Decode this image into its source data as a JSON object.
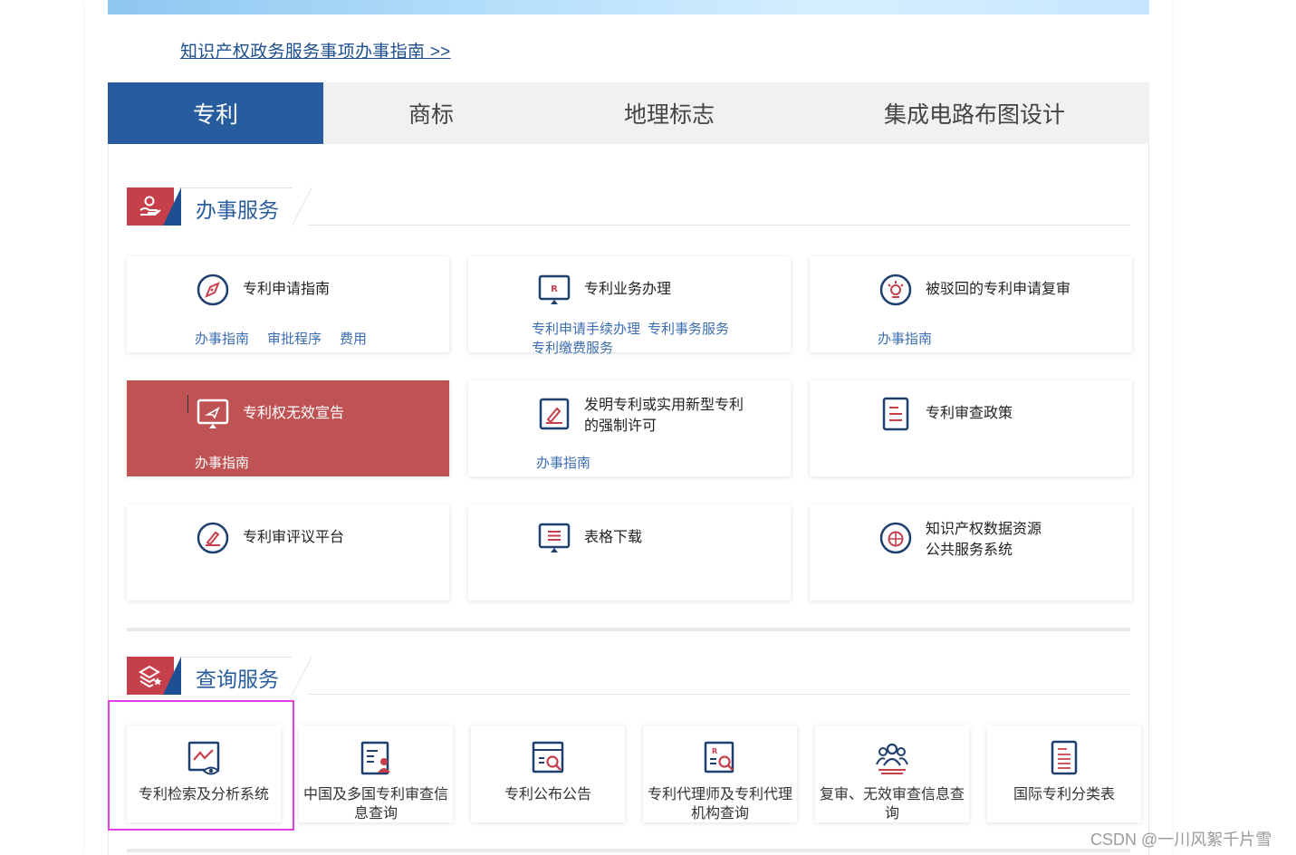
{
  "guide_link": "知识产权政务服务事项办事指南 >>",
  "tabs": [
    {
      "label": "专利",
      "active": true
    },
    {
      "label": "商标",
      "active": false
    },
    {
      "label": "地理标志",
      "active": false
    },
    {
      "label": "集成电路布图设计",
      "active": false
    }
  ],
  "sections": {
    "affairs": {
      "title": "办事服务",
      "icon": "hand-service-icon"
    },
    "query": {
      "title": "查询服务",
      "icon": "stack-star-icon"
    }
  },
  "affair_cards": [
    {
      "title": "专利申请指南",
      "icon": "compass-icon",
      "links": [
        "办事指南",
        "审批程序",
        "费用"
      ]
    },
    {
      "title": "专利业务办理",
      "icon": "monitor-r-icon",
      "links": [
        "专利申请手续办理",
        "专利事务服务",
        "专利缴费服务"
      ]
    },
    {
      "title": "被驳回的专利申请复审",
      "icon": "bulb-icon",
      "links": [
        "办事指南"
      ]
    },
    {
      "title": "专利权无效宣告",
      "icon": "monitor-send-icon",
      "links": [
        "办事指南"
      ]
    },
    {
      "title_line1": "发明专利或实用新型专利",
      "title_line2": "的强制许可",
      "icon": "pen-document-icon",
      "links": [
        "办事指南"
      ]
    },
    {
      "title": "专利审查政策",
      "icon": "document-lines-icon",
      "links": []
    },
    {
      "title": "专利审评议平台",
      "icon": "pen-circle-icon",
      "links": []
    },
    {
      "title": "表格下载",
      "icon": "monitor-list-icon",
      "links": []
    },
    {
      "title_line1": "知识产权数据资源",
      "title_line2": "公共服务系统",
      "icon": "database-globe-icon",
      "links": []
    }
  ],
  "query_cards": [
    {
      "label": "专利检索及分析系统",
      "icon": "chart-eye-icon"
    },
    {
      "label": "中国及多国专利审查信息查询",
      "icon": "document-person-icon"
    },
    {
      "label": "专利公布公告",
      "icon": "document-search-icon"
    },
    {
      "label": "专利代理师及专利代理机构查询",
      "icon": "document-r-search-icon"
    },
    {
      "label": "复审、无效审查信息查询",
      "icon": "people-group-icon"
    },
    {
      "label": "国际专利分类表",
      "icon": "document-list-icon"
    }
  ],
  "watermark": "CSDN @一川风絮千片雪",
  "colors": {
    "primary": "#275c9e",
    "accent_red": "#c6404c",
    "highlight": "#bf5354",
    "link": "#3b6db0",
    "focus": "#e13ee6"
  }
}
